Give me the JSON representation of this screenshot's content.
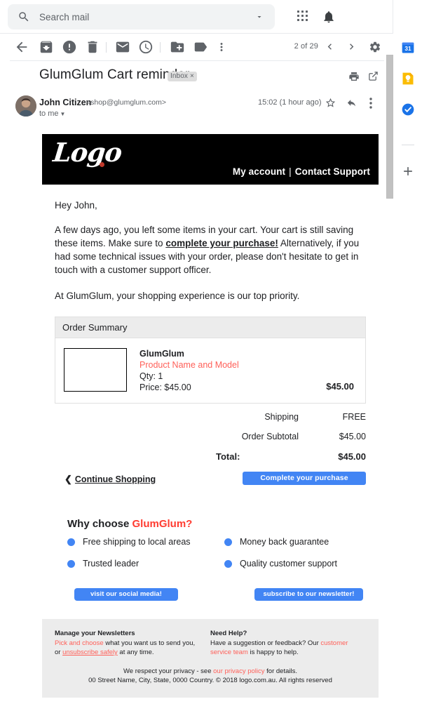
{
  "search": {
    "placeholder": "Search mail",
    "value": "",
    "icon": "search-icon",
    "caret_icon": "chevron-down-icon"
  },
  "topbar": {
    "apps_icon": "grid-apps-icon",
    "notifications_icon": "bell-icon"
  },
  "toolbar": {
    "back_icon": "back-arrow-icon",
    "archive_icon": "archive-icon",
    "spam_icon": "report-spam-icon",
    "delete_icon": "trash-icon",
    "unread_icon": "mark-unread-icon",
    "snooze_icon": "snooze-clock-icon",
    "moveto_icon": "move-to-folder-icon",
    "labels_icon": "label-tag-icon",
    "more_icon": "more-vertical-icon",
    "pagecount": "2 of 29",
    "prev_icon": "chevron-left-icon",
    "next_icon": "chevron-right-icon",
    "settings_icon": "gear-icon"
  },
  "rail": {
    "items": [
      {
        "name": "google-calendar-icon",
        "label": "31"
      },
      {
        "name": "google-keep-icon",
        "label": ""
      },
      {
        "name": "google-tasks-icon",
        "label": ""
      }
    ],
    "add_icon": "plus-icon"
  },
  "email_header": {
    "subject": "GlumGlum Cart reminder",
    "label_chip": "Inbox",
    "label_chip_remove": "×",
    "print_icon": "print-icon",
    "popout_icon": "open-in-new-window-icon",
    "sender_name": "John Citizen",
    "sender_email": "<shop@glumglum.com>",
    "recipients": "to me",
    "time": "15:02 (1 hour ago)",
    "star_icon": "star-icon",
    "reply_icon": "reply-arrow-icon",
    "more_icon": "more-vertical-icon"
  },
  "banner": {
    "logo_text": "Logo",
    "logo_dot_color": "#c0392b",
    "links": [
      {
        "label": "My account"
      },
      {
        "label": "Contact Support"
      }
    ],
    "separator": "|",
    "background": "#000000"
  },
  "body": {
    "greeting": "Hey John,",
    "para1_before": "A few days ago, you left some items in your cart. Your cart is still saving these items. Make sure to ",
    "para1_link": "complete your purchase!",
    "para1_after": " Alternatively, if you had some technical issues with your order, please don't hesitate to get in touch with a customer support officer.",
    "para2": "At GlumGlum, your shopping experience is our top priority."
  },
  "order": {
    "heading": "Order Summary",
    "item": {
      "brand": "GlumGlum",
      "product": "Product Name and Model",
      "qty": "Qty: 1",
      "price_label": "Price: $45.00",
      "line_total": "$45.00",
      "thumb": "product-image-placeholder"
    },
    "totals": [
      {
        "label": "Shipping",
        "value": "FREE"
      },
      {
        "label": "Order Subtotal",
        "value": "$45.00"
      }
    ],
    "grand": {
      "label": "Total:",
      "value": "$45.00"
    },
    "continue_label": "Continue Shopping",
    "continue_chevron": "❮",
    "cta_label": "Complete your purchase",
    "cta_color": "#4285f4"
  },
  "why": {
    "heading_prefix": "Why choose ",
    "heading_brand": "GlumGlum?",
    "brand_color": "#ff3b30",
    "benefits": [
      "Free shipping to local areas",
      "Money back guarantee",
      "Trusted leader",
      "Quality customer support"
    ],
    "bullet_color": "#4285f4",
    "social_button": "visit our social media!",
    "newsletter_button": "subscribe to our newsletter!"
  },
  "footer": {
    "col1_heading": "Manage your Newsletters",
    "col1_link1": "Pick and choose",
    "col1_text1": " what you want us to send you,",
    "col1_text2": "or ",
    "col1_link2": "unsubscribe safely",
    "col1_text3": " at any time.",
    "col2_heading": "Need Help?",
    "col2_text1": "Have a suggestion or feedback? Our ",
    "col2_link": "customer service team",
    "col2_text2": " is happy to help.",
    "fine_text1": "We respect your privacy - see ",
    "fine_link": "our privacy policy",
    "fine_text2": " for details.",
    "fine_line2": "00 Street Name, City, State, 0000 Country. © 2018 logo.com.au. All rights reserved",
    "link_color": "#ff6059",
    "background": "#ececec"
  }
}
